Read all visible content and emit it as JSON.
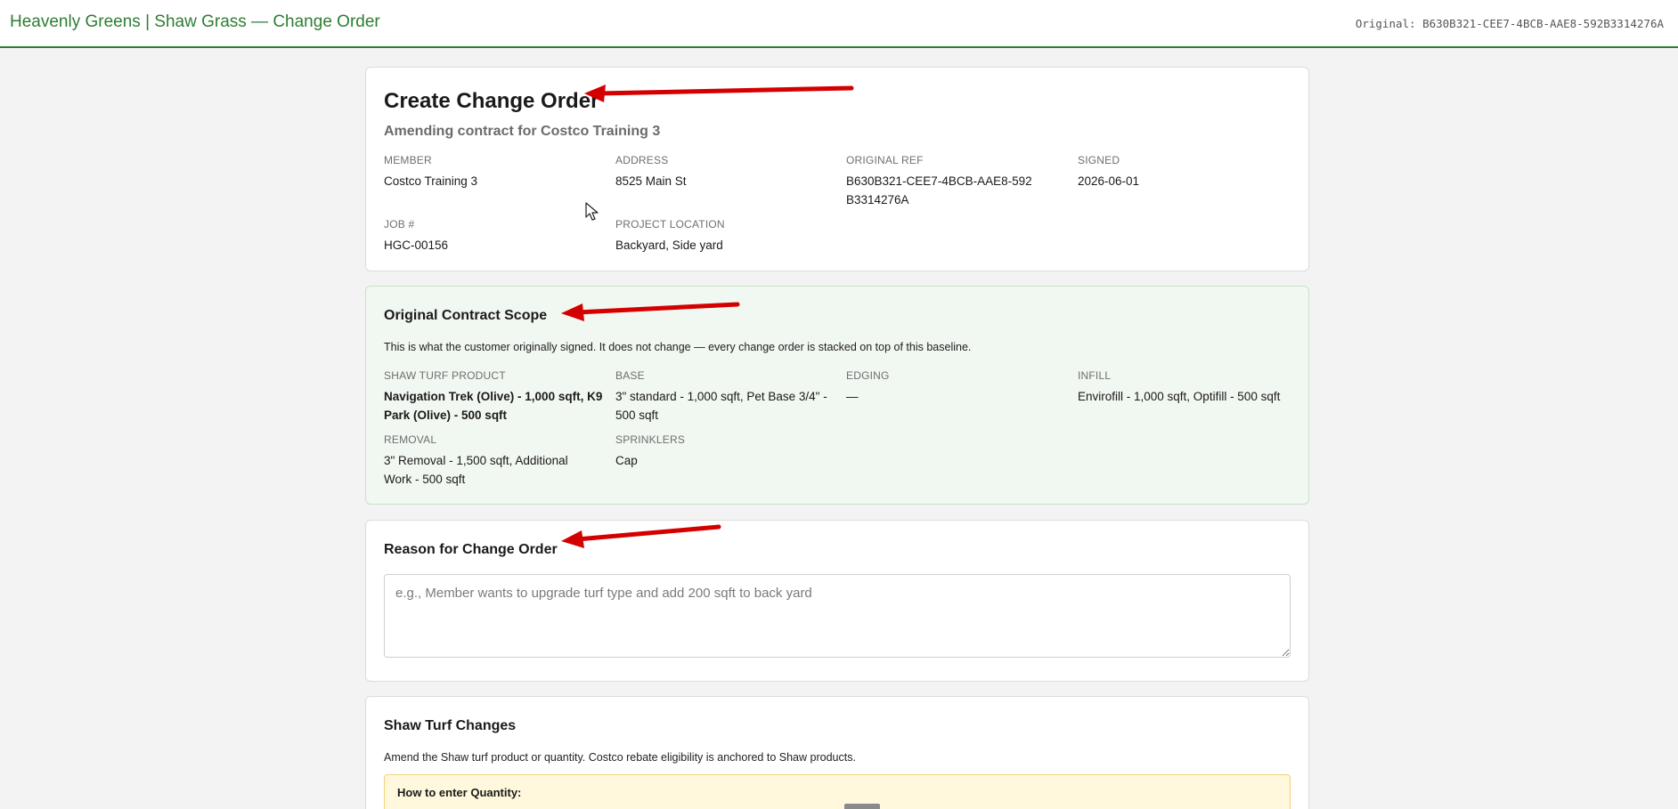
{
  "header": {
    "title": "Heavenly Greens | Shaw Grass — Change Order",
    "original_label": "Original: B630B321-CEE7-4BCB-AAE8-592B3314276A"
  },
  "create": {
    "title": "Create Change Order",
    "subtitle": "Amending contract for Costco Training 3",
    "fields": [
      {
        "label": "MEMBER",
        "value": "Costco Training 3"
      },
      {
        "label": "ADDRESS",
        "value": "8525 Main St"
      },
      {
        "label": "ORIGINAL REF",
        "value": "B630B321-CEE7-4BCB-AAE8-592B3314276A"
      },
      {
        "label": "SIGNED",
        "value": "2026-06-01"
      },
      {
        "label": "JOB #",
        "value": "HGC-00156"
      },
      {
        "label": "PROJECT LOCATION",
        "value": "Backyard, Side yard"
      }
    ]
  },
  "scope": {
    "title": "Original Contract Scope",
    "description": "This is what the customer originally signed. It does not change — every change order is stacked on top of this baseline.",
    "fields": [
      {
        "label": "SHAW TURF PRODUCT",
        "value": "Navigation Trek (Olive) - 1,000 sqft, K9 Park (Olive) - 500 sqft"
      },
      {
        "label": "BASE",
        "value": "3\" standard - 1,000 sqft, Pet Base 3/4\" - 500 sqft"
      },
      {
        "label": "EDGING",
        "value": "—"
      },
      {
        "label": "INFILL",
        "value": "Envirofill - 1,000 sqft, Optifill - 500 sqft"
      },
      {
        "label": "REMOVAL",
        "value": "3\" Removal - 1,500 sqft, Additional Work - 500 sqft"
      },
      {
        "label": "SPRINKLERS",
        "value": "Cap"
      }
    ]
  },
  "reason": {
    "title": "Reason for Change Order",
    "placeholder": "e.g., Member wants to upgrade turf type and add 200 sqft to back yard"
  },
  "turf": {
    "title": "Shaw Turf Changes",
    "description": "Amend the Shaw turf product or quantity. Costco rebate eligibility is anchored to Shaw products.",
    "notice_title": "How to enter Quantity:"
  },
  "colors": {
    "brand_green": "#2e7d32",
    "arrow_red": "#d40000"
  }
}
